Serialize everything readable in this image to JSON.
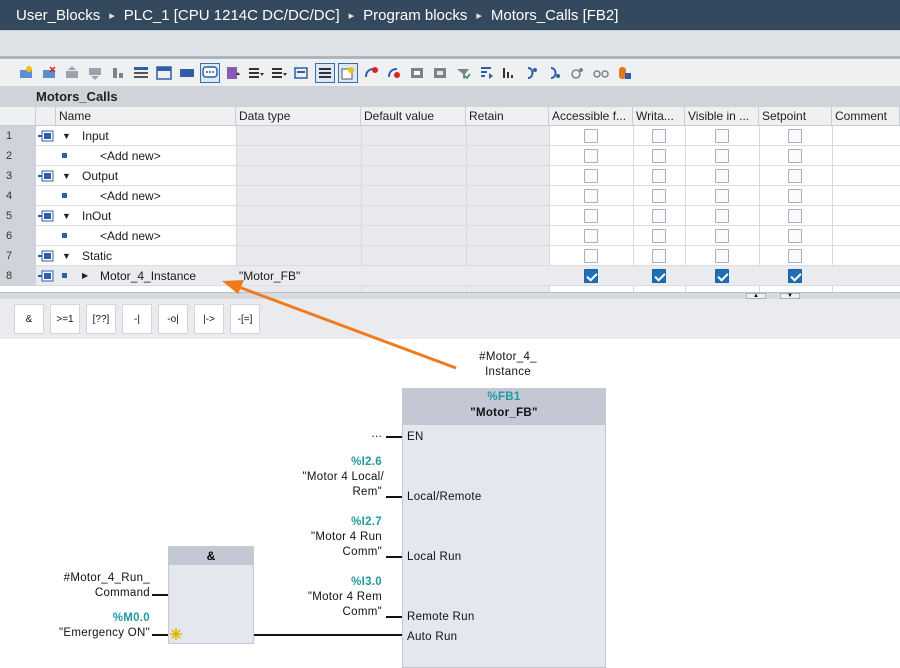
{
  "breadcrumb": [
    "User_Blocks",
    "PLC_1 [CPU 1214C DC/DC/DC]",
    "Program blocks",
    "Motors_Calls [FB2]"
  ],
  "breadcrumb_separator": "▸",
  "block_name": "Motors_Calls",
  "columns": {
    "name": "Name",
    "data_type": "Data type",
    "default_value": "Default value",
    "retain": "Retain",
    "accessible": "Accessible f...",
    "writable": "Writa...",
    "visible": "Visible in ...",
    "setpoint": "Setpoint",
    "comment": "Comment"
  },
  "rows": [
    {
      "num": "1",
      "name": "Input",
      "type": "section"
    },
    {
      "num": "2",
      "name": "<Add new>",
      "type": "add"
    },
    {
      "num": "3",
      "name": "Output",
      "type": "section"
    },
    {
      "num": "4",
      "name": "<Add new>",
      "type": "add"
    },
    {
      "num": "5",
      "name": "InOut",
      "type": "section"
    },
    {
      "num": "6",
      "name": "<Add new>",
      "type": "add"
    },
    {
      "num": "7",
      "name": "Static",
      "type": "section"
    },
    {
      "num": "8",
      "name": "Motor_4_Instance",
      "data_type": "\"Motor_FB\"",
      "type": "var",
      "accessible": true,
      "writable": true,
      "visible": true,
      "setpoint": true
    }
  ],
  "lad_instructions": [
    "&",
    ">=1",
    "[??]",
    "-|",
    "-o|",
    "|->",
    "-[=]"
  ],
  "network": {
    "instance_label_line1": "#Motor_4_",
    "instance_label_line2": "Instance",
    "fb_address": "%FB1",
    "fb_name": "\"Motor_FB\"",
    "pins": {
      "en": "EN",
      "en_input": "...",
      "local_remote": "Local/Remote",
      "local_run": "Local Run",
      "remote_run": "Remote Run",
      "auto_run": "Auto Run"
    },
    "inputs": {
      "i26_addr": "%I2.6",
      "i26_name1": "\"Motor 4 Local/",
      "i26_name2": "Rem\"",
      "i27_addr": "%I2.7",
      "i27_name1": "\"Motor 4 Run",
      "i27_name2": "Comm\"",
      "i30_addr": "%I3.0",
      "i30_name1": "\"Motor 4 Rem",
      "i30_name2": "Comm\""
    },
    "and_block": {
      "label": "&",
      "in1_line1": "#Motor_4_Run_",
      "in1_line2": "Command",
      "in2_addr": "%M0.0",
      "in2_name": "\"Emergency ON\""
    }
  },
  "colors": {
    "breadcrumb_bg": "#34495e",
    "address_teal": "#1f9aa0",
    "arrow_orange": "#f07b1d",
    "checkbox_blue": "#1f6fb5"
  }
}
